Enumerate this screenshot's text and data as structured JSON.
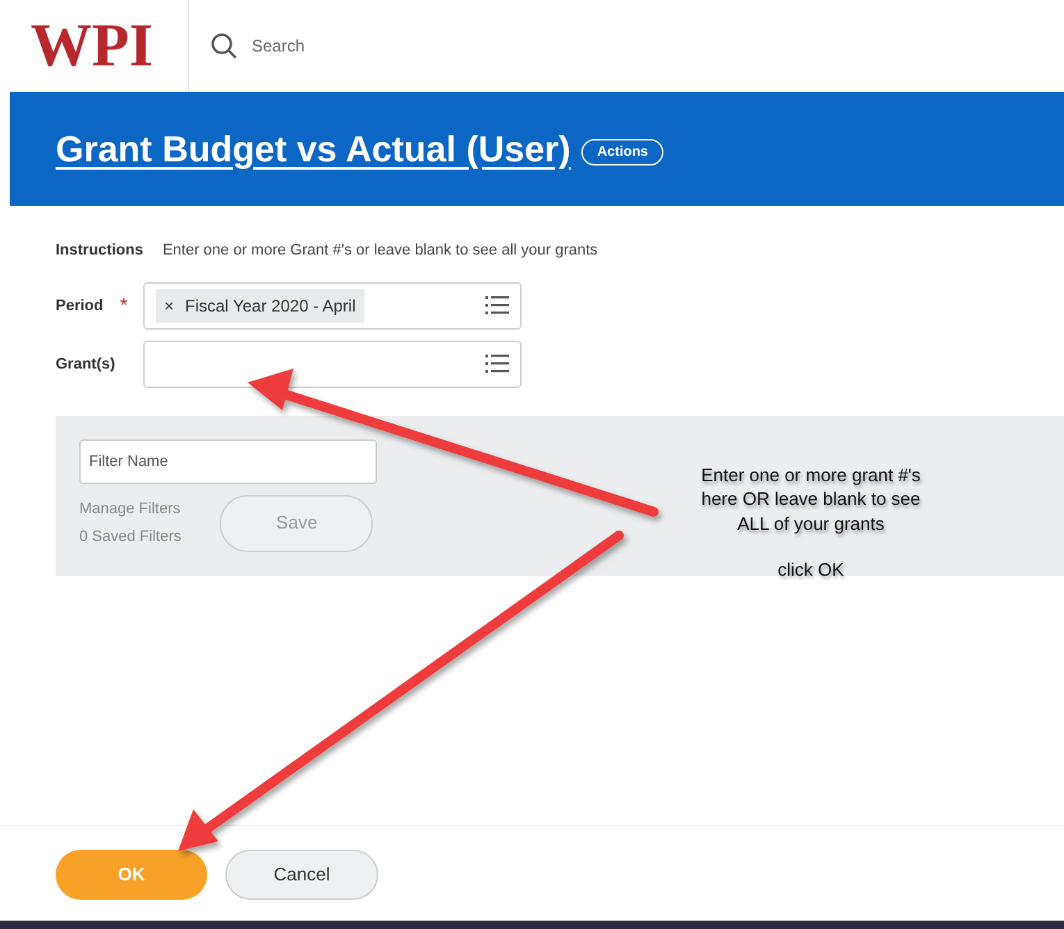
{
  "header": {
    "logo": "WPI",
    "search": {
      "placeholder": "Search"
    }
  },
  "banner": {
    "title": "Grant Budget vs Actual (User)",
    "actions_button": "Actions"
  },
  "instructions": {
    "label": "Instructions",
    "text": "Enter one or more Grant #'s or leave blank to see all your grants"
  },
  "fields": [
    {
      "label": "Period",
      "required": true,
      "required_mark": "*",
      "tokens": [
        {
          "remove": "×",
          "text": "Fiscal Year 2020 - April"
        }
      ]
    },
    {
      "label": "Grant(s)",
      "required": false
    }
  ],
  "filter_panel": {
    "filter_name": {
      "placeholder": "Filter Name"
    },
    "manage_filters": "Manage Filters",
    "saved_filters": "0 Saved Filters",
    "save_button": "Save"
  },
  "annotation": {
    "lines": [
      "Enter one or more grant #'s",
      "here OR leave blank to see",
      "ALL of your grants",
      "click OK"
    ]
  },
  "buttons": [
    {
      "label": "OK",
      "kind": "primary"
    },
    {
      "label": "Cancel",
      "kind": "secondary"
    }
  ]
}
